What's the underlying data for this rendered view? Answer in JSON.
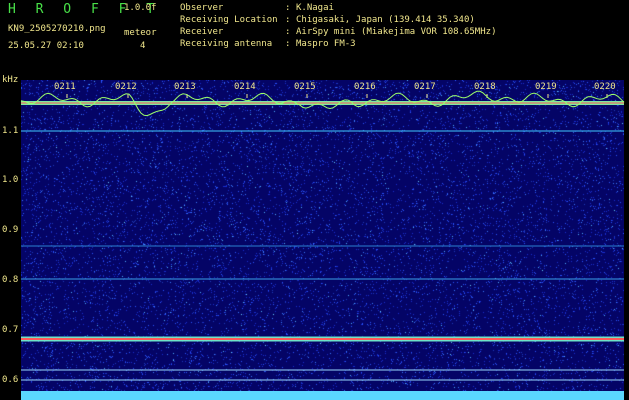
{
  "header": {
    "title": "H R O F F T",
    "version": "1.0.0f",
    "filename": "KN9_2505270210.png",
    "meteor_label": "meteor",
    "meteor_count": "4",
    "timestamp": "25.05.27 02:10"
  },
  "station": [
    {
      "label": "Observer",
      "value": "K.Nagai"
    },
    {
      "label": "Receiving Location",
      "value": "Chigasaki, Japan (139.414 35.340)"
    },
    {
      "label": "Receiver",
      "value": "AirSpy mini (Miakejima VOR 108.65MHz)"
    },
    {
      "label": "Receiving antenna",
      "value": "Maspro FM-3"
    }
  ],
  "plot": {
    "y_unit": "kHz",
    "y_ticks": [
      "1.1",
      "1.0",
      "0.9",
      "0.8",
      "0.7",
      "0.6"
    ],
    "time_ticks": [
      "0211",
      "0212",
      "0213",
      "0214",
      "0215",
      "0216",
      "0217",
      "0218",
      "0219",
      "0220"
    ],
    "background_color": "#040466",
    "trace_color": "#9cff6a",
    "carrier_color": "#ff5a5a"
  }
}
